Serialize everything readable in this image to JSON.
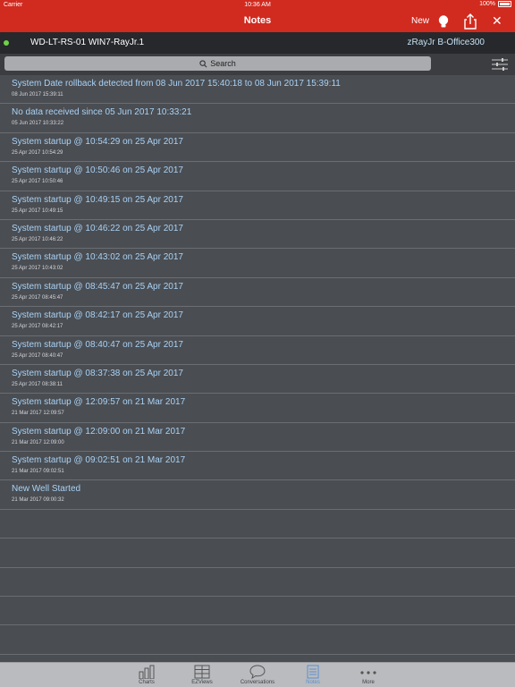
{
  "status": {
    "carrier": "Carrier",
    "time": "10:36 AM",
    "battery": "100%"
  },
  "nav": {
    "title": "Notes",
    "new_label": "New",
    "close_glyph": "✕"
  },
  "device": {
    "name": "WD-LT-RS-01 WIN7-RayJr.1",
    "account": "zRayJr B-Office300",
    "status_color": "#6fd24a"
  },
  "search": {
    "label": "Search"
  },
  "notes": [
    {
      "title": "System Date rollback detected from 08 Jun 2017 15:40:18 to 08 Jun 2017 15:39:11",
      "date": "08 Jun 2017 15:39:11"
    },
    {
      "title": "No data received since 05 Jun 2017 10:33:21",
      "date": "05 Jun 2017 10:33:22"
    },
    {
      "title": "System startup @ 10:54:29 on 25 Apr 2017",
      "date": "25 Apr 2017 10:54:29"
    },
    {
      "title": "System startup @ 10:50:46 on 25 Apr 2017",
      "date": "25 Apr 2017 10:50:46"
    },
    {
      "title": "System startup @ 10:49:15 on 25 Apr 2017",
      "date": "25 Apr 2017 10:49:15"
    },
    {
      "title": "System startup @ 10:46:22 on 25 Apr 2017",
      "date": "25 Apr 2017 10:46:22"
    },
    {
      "title": "System startup @ 10:43:02 on 25 Apr 2017",
      "date": "25 Apr 2017 10:43:02"
    },
    {
      "title": "System startup @ 08:45:47 on 25 Apr 2017",
      "date": "25 Apr 2017 08:45:47"
    },
    {
      "title": "System startup @ 08:42:17 on 25 Apr 2017",
      "date": "25 Apr 2017 08:42:17"
    },
    {
      "title": "System startup @ 08:40:47 on 25 Apr 2017",
      "date": "25 Apr 2017 08:40:47"
    },
    {
      "title": "System startup @ 08:37:38 on 25 Apr 2017",
      "date": "25 Apr 2017 08:38:11"
    },
    {
      "title": "System startup @ 12:09:57 on 21 Mar 2017",
      "date": "21 Mar 2017 12:09:57"
    },
    {
      "title": "System startup @ 12:09:00 on 21 Mar 2017",
      "date": "21 Mar 2017 12:09:00"
    },
    {
      "title": "System startup @ 09:02:51 on 21 Mar 2017",
      "date": "21 Mar 2017 09:02:51"
    },
    {
      "title": "New Well Started",
      "date": "21 Mar 2017 09:00:32"
    },
    {
      "title": "",
      "date": ""
    },
    {
      "title": "",
      "date": ""
    },
    {
      "title": "",
      "date": ""
    },
    {
      "title": "",
      "date": ""
    },
    {
      "title": "",
      "date": ""
    }
  ],
  "tabs": [
    {
      "label": "Charts",
      "icon": "bar-chart-icon"
    },
    {
      "label": "EZViews",
      "icon": "grid-icon"
    },
    {
      "label": "Conversations",
      "icon": "chat-bubble-icon"
    },
    {
      "label": "Notes",
      "icon": "notes-icon"
    },
    {
      "label": "More",
      "icon": "more-dots-icon"
    }
  ],
  "colors": {
    "brand": "#d12a1f",
    "link": "#a9d2f5",
    "active_tab": "#5b8fd0"
  }
}
